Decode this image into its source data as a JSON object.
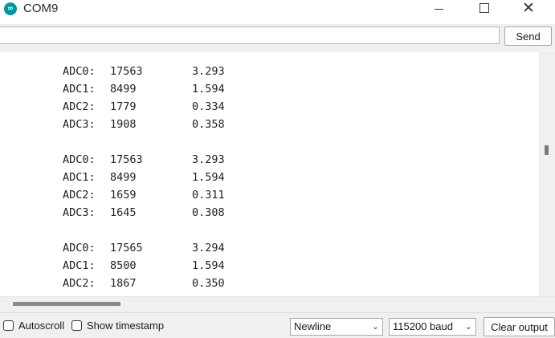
{
  "window": {
    "title": "COM9",
    "minimize_glyph": "",
    "maximize_glyph": "",
    "close_glyph": "✕"
  },
  "input": {
    "value": "",
    "send_label": "Send"
  },
  "output": {
    "lines": [
      {
        "label": "ADC0:",
        "raw": "17563",
        "volts": "3.293"
      },
      {
        "label": "ADC1:",
        "raw": "8499",
        "volts": "1.594"
      },
      {
        "label": "ADC2:",
        "raw": "1779",
        "volts": "0.334"
      },
      {
        "label": "ADC3:",
        "raw": "1908",
        "volts": "0.358"
      },
      {
        "label": "ADC0:",
        "raw": "17563",
        "volts": "3.293"
      },
      {
        "label": "ADC1:",
        "raw": "8499",
        "volts": "1.594"
      },
      {
        "label": "ADC2:",
        "raw": "1659",
        "volts": "0.311"
      },
      {
        "label": "ADC3:",
        "raw": "1645",
        "volts": "0.308"
      },
      {
        "label": "ADC0:",
        "raw": "17565",
        "volts": "3.294"
      },
      {
        "label": "ADC1:",
        "raw": "8500",
        "volts": "1.594"
      },
      {
        "label": "ADC2:",
        "raw": "1867",
        "volts": "0.350"
      }
    ]
  },
  "bottom": {
    "autoscroll_label": "Autoscroll",
    "autoscroll_checked": false,
    "timestamp_label": "Show timestamp",
    "timestamp_checked": false,
    "line_ending": "Newline",
    "baud_rate": "115200 baud",
    "clear_label": "Clear output"
  },
  "icons": {
    "app": "arduino-icon",
    "dropdown": "chevron-down-icon"
  },
  "colors": {
    "accent": "#00979c",
    "chrome": "#f0f0f0"
  }
}
